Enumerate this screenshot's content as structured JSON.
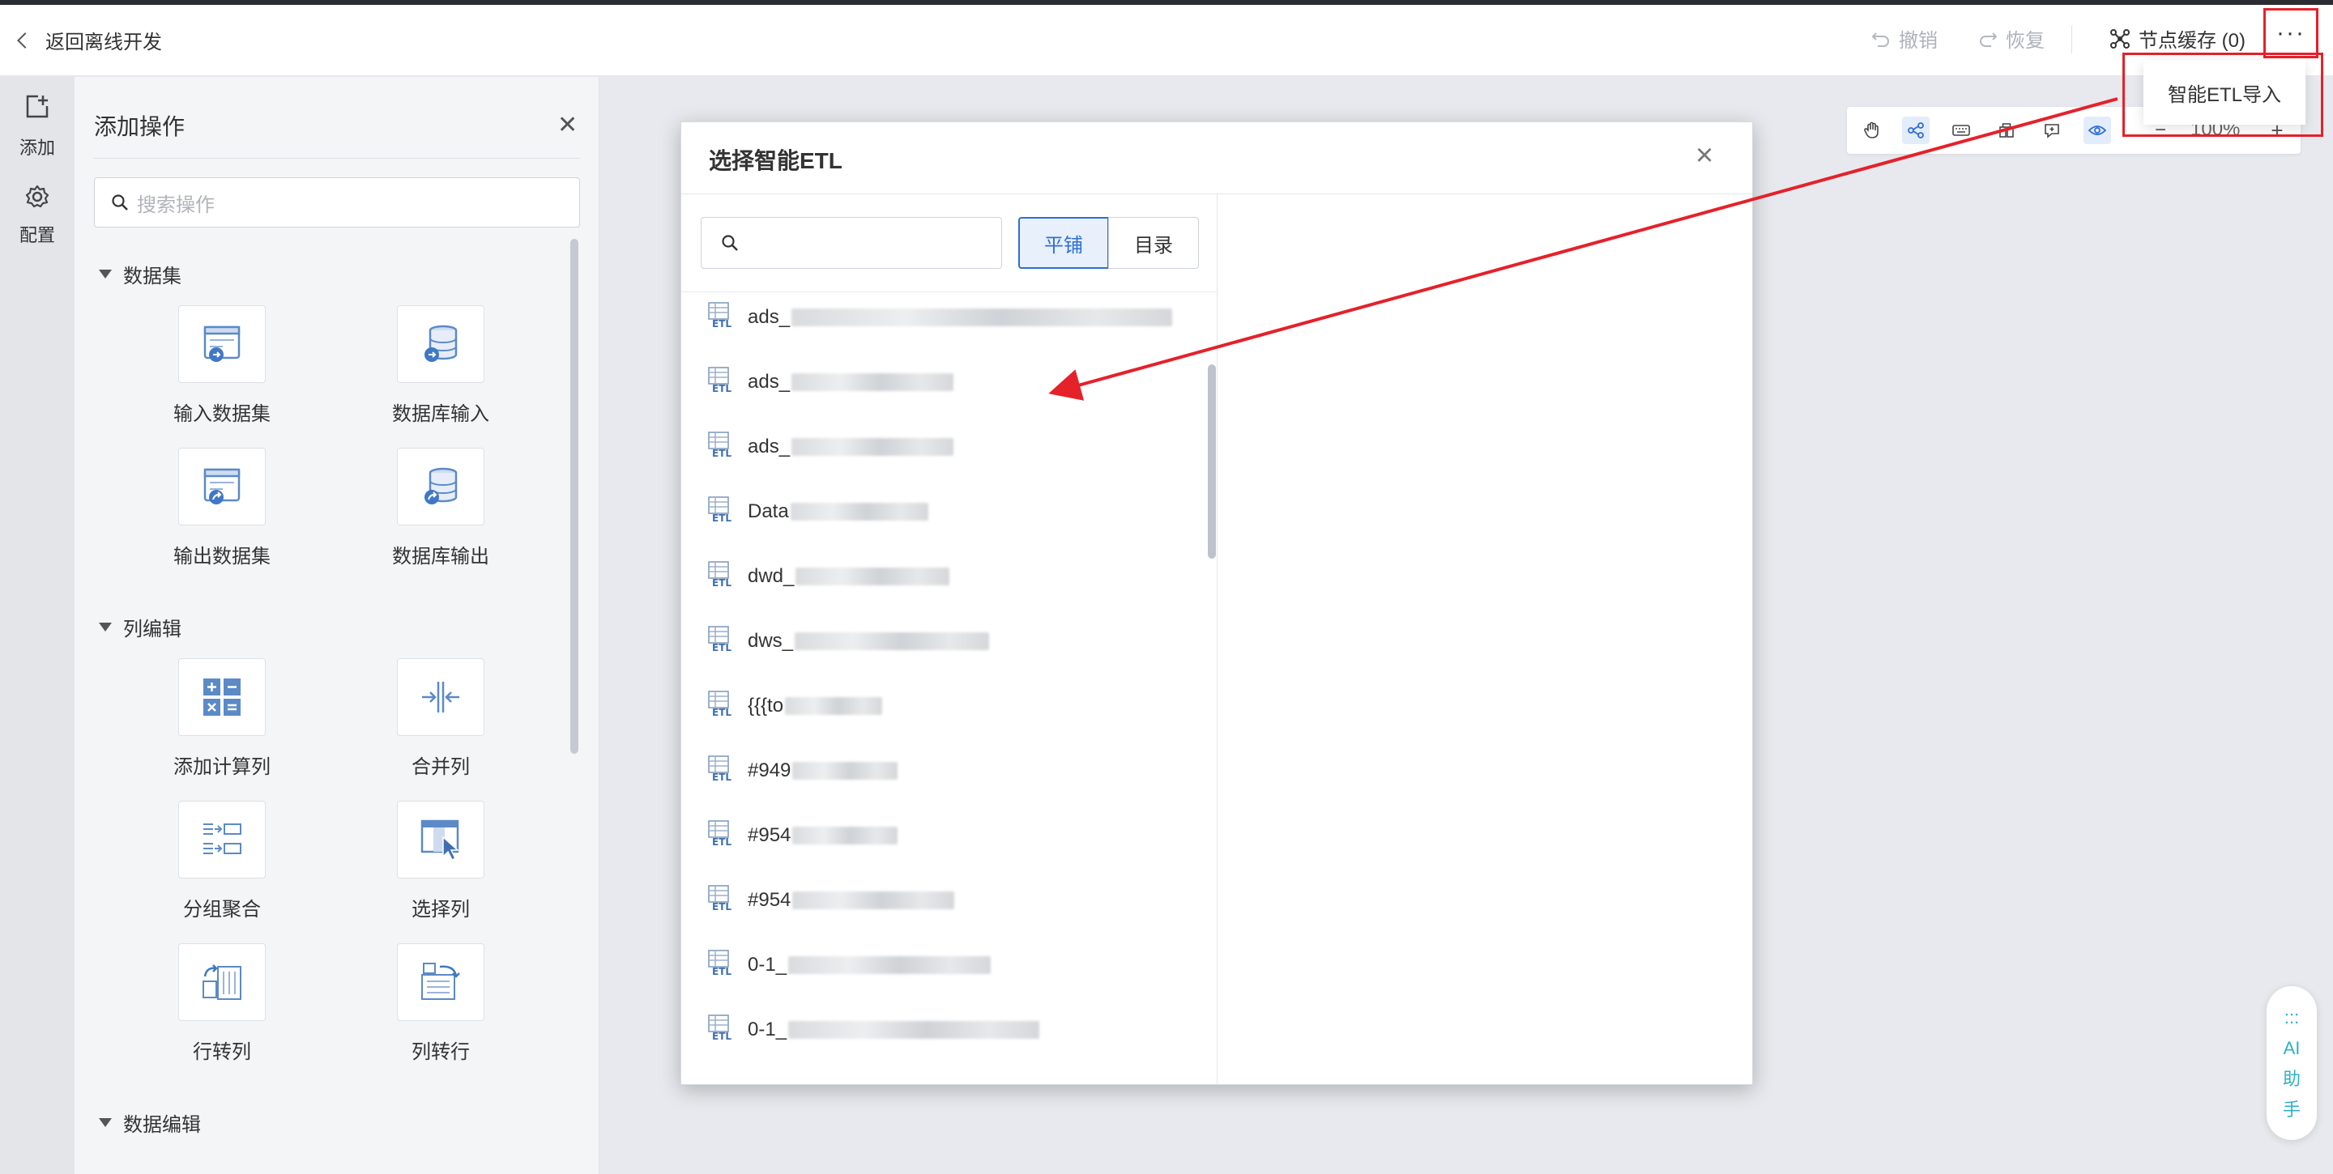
{
  "topbar": {
    "back_label": "返回离线开发",
    "undo_label": "撤销",
    "redo_label": "恢复",
    "node_cache_label": "节点缓存 (0)",
    "more_label": "···"
  },
  "dropdown": {
    "item_label": "智能ETL导入"
  },
  "left_rail": {
    "add_label": "添加",
    "config_label": "配置"
  },
  "panel": {
    "title": "添加操作",
    "search_placeholder": "搜索操作",
    "sections": [
      {
        "title": "数据集",
        "items": [
          "输入数据集",
          "数据库输入",
          "输出数据集",
          "数据库输出"
        ]
      },
      {
        "title": "列编辑",
        "items": [
          "添加计算列",
          "合并列",
          "分组聚合",
          "选择列",
          "行转列",
          "列转行"
        ]
      },
      {
        "title": "数据编辑",
        "items": []
      }
    ]
  },
  "canvas_toolbar": {
    "zoom_label": "100%",
    "zoom_out": "−",
    "zoom_in": "+"
  },
  "modal": {
    "title": "选择智能ETL",
    "search_value": "",
    "view_tile_label": "平铺",
    "view_dir_label": "目录",
    "items": [
      "ads_",
      "ads_",
      "ads_",
      "Data",
      "dwd_",
      "dws_",
      "{{{to",
      "#949",
      "#954",
      "#954",
      "0-1_",
      "0-1_"
    ]
  },
  "ai_assistant": {
    "dots": ":::",
    "label_1": "AI",
    "label_2": "助",
    "label_3": "手"
  },
  "colors": {
    "accent": "#2c6fd6",
    "annotation_red": "#e5212a",
    "ai_teal": "#2fb0c8"
  }
}
